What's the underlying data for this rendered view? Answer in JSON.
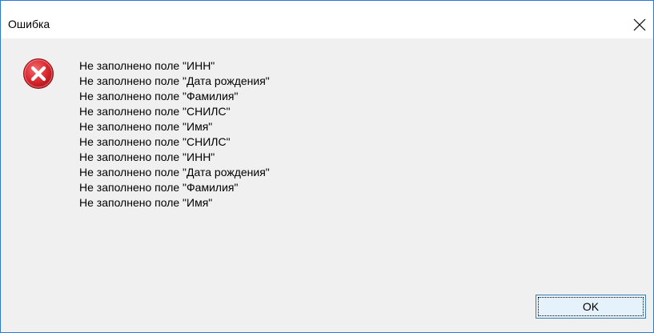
{
  "window": {
    "title": "Ошибка",
    "close_icon": "close-icon"
  },
  "dialog": {
    "icon": "error-icon",
    "icon_color": "#d9272e",
    "messages": [
      "Не заполнено поле \"ИНН\"",
      "Не заполнено поле \"Дата рождения\"",
      "Не заполнено поле \"Фамилия\"",
      "Не заполнено поле \"СНИЛС\"",
      "Не заполнено поле \"Имя\"",
      "Не заполнено поле \"СНИЛС\"",
      "Не заполнено поле \"ИНН\"",
      "Не заполнено поле \"Дата рождения\"",
      "Не заполнено поле \"Фамилия\"",
      "Не заполнено поле \"Имя\""
    ],
    "ok_label": "OK"
  }
}
